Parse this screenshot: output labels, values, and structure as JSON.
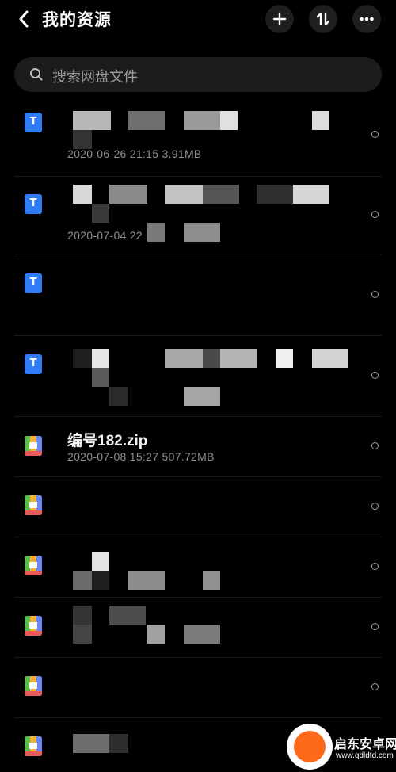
{
  "header": {
    "title": "我的资源",
    "back_icon": "chevron-left-icon",
    "add_icon": "plus-icon",
    "sort_icon": "sort-icon",
    "more_icon": "more-icon"
  },
  "search": {
    "placeholder": "搜索网盘文件"
  },
  "files": [
    {
      "type": "txt",
      "icon_label": "T",
      "name": "",
      "meta": "2020-06-26  21:15  3.91MB"
    },
    {
      "type": "txt",
      "icon_label": "T",
      "name": "",
      "meta": "2020-07-04  22"
    },
    {
      "type": "txt",
      "icon_label": "T",
      "name": "",
      "meta": ""
    },
    {
      "type": "txt",
      "icon_label": "T",
      "name": "",
      "meta": ""
    },
    {
      "type": "zip",
      "icon_label": "",
      "name": "编号182.zip",
      "meta": "2020-07-08  15:27  507.72MB"
    },
    {
      "type": "zip",
      "icon_label": "",
      "name": "",
      "meta": ""
    },
    {
      "type": "zip",
      "icon_label": "",
      "name": "",
      "meta": ""
    },
    {
      "type": "zip",
      "icon_label": "",
      "name": "",
      "meta": ""
    },
    {
      "type": "zip",
      "icon_label": "",
      "name": "",
      "meta": ""
    },
    {
      "type": "zip",
      "icon_label": "",
      "name": "",
      "meta": ""
    }
  ],
  "watermark": {
    "text": "启东安卓网",
    "url": "www.qdldtd.com"
  },
  "colors": {
    "background": "#000000",
    "txt_icon": "#2f7cf6",
    "zip_icon": "#f2b23a"
  }
}
